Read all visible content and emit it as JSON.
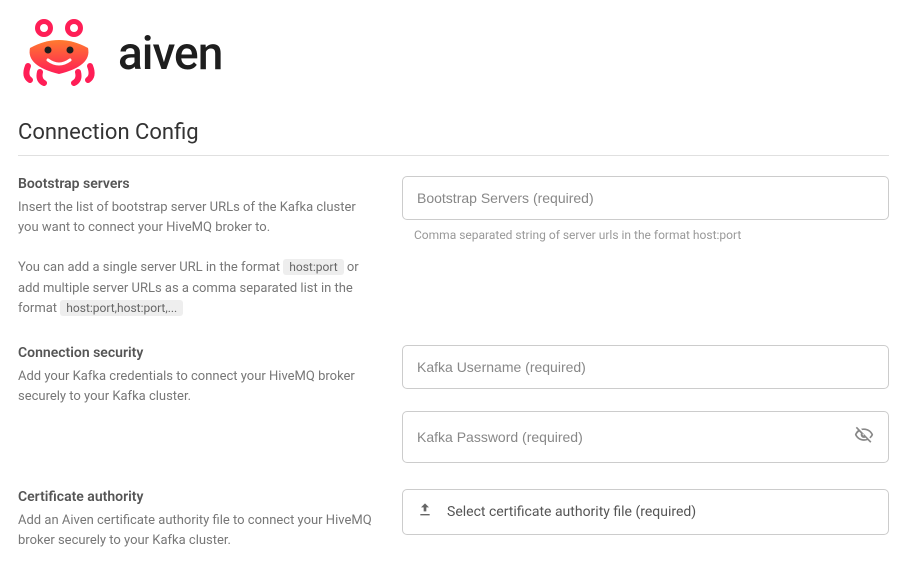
{
  "brand": {
    "name": "aiven"
  },
  "section_title": "Connection Config",
  "bootstrap": {
    "label": "Bootstrap servers",
    "desc_line1": "Insert the list of bootstrap server URLs of the Kafka cluster you want to connect your HiveMQ broker to.",
    "desc_line2a": "You can add a single server URL in the format ",
    "chip1": "host:port",
    "desc_line2b": " or add multiple server URLs as a comma separated list in the format ",
    "chip2": "host:port,host:port,...",
    "placeholder": "Bootstrap Servers (required)",
    "helper": "Comma separated string of server urls in the format host:port"
  },
  "security": {
    "label": "Connection security",
    "desc": "Add your Kafka credentials to connect your HiveMQ broker securely to your Kafka cluster.",
    "username_placeholder": "Kafka Username (required)",
    "password_placeholder": "Kafka Password (required)"
  },
  "ca": {
    "label": "Certificate authority",
    "desc": "Add an Aiven certificate authority file to connect your HiveMQ broker securely to your Kafka cluster.",
    "button_label": "Select certificate authority file (required)"
  }
}
